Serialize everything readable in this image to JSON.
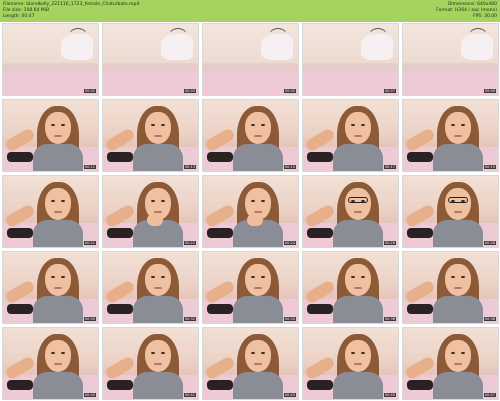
{
  "header": {
    "filename": "Filename: blondkelly_221116_1723_female_Chaturbate.mp4",
    "filesize": "File size: 108.64 MiB",
    "length": "Length: 00:47",
    "dimensions": "Dimensions: 640x480",
    "format": "Format: H264 / aac (mono)",
    "fps": "FPS: 30.00"
  },
  "thumbnails": [
    {
      "time": "00:01",
      "scene": "empty"
    },
    {
      "time": "00:03",
      "scene": "empty"
    },
    {
      "time": "00:05",
      "scene": "empty"
    },
    {
      "time": "00:07",
      "scene": "empty"
    },
    {
      "time": "00:09",
      "scene": "empty"
    },
    {
      "time": "00:11",
      "scene": "person"
    },
    {
      "time": "00:13",
      "scene": "person"
    },
    {
      "time": "00:15",
      "scene": "person"
    },
    {
      "time": "00:17",
      "scene": "person"
    },
    {
      "time": "00:19",
      "scene": "person"
    },
    {
      "time": "00:21",
      "scene": "person"
    },
    {
      "time": "00:22",
      "scene": "person-hand"
    },
    {
      "time": "00:24",
      "scene": "person-hand"
    },
    {
      "time": "00:26",
      "scene": "person-glasses"
    },
    {
      "time": "00:28",
      "scene": "person-glasses"
    },
    {
      "time": "00:30",
      "scene": "person"
    },
    {
      "time": "00:32",
      "scene": "person"
    },
    {
      "time": "00:34",
      "scene": "person"
    },
    {
      "time": "00:36",
      "scene": "person"
    },
    {
      "time": "00:38",
      "scene": "person"
    },
    {
      "time": "00:40",
      "scene": "person"
    },
    {
      "time": "00:41",
      "scene": "person"
    },
    {
      "time": "00:43",
      "scene": "person"
    },
    {
      "time": "00:45",
      "scene": "person"
    },
    {
      "time": "00:47",
      "scene": "person"
    }
  ]
}
